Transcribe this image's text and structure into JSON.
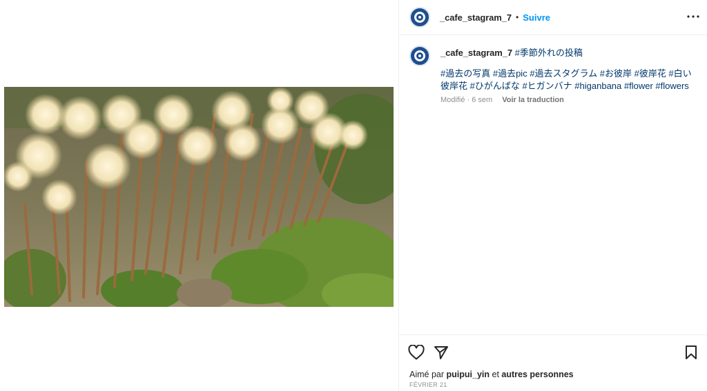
{
  "post": {
    "username": "_cafe_stagram_7",
    "separator": "•",
    "follow_label": "Suivre",
    "more_icon": "more-horizontal-icon",
    "caption_tag": "#季節外れの投稿",
    "hashtags": "#過去の写真 #過去pic #過去スタグラム #お彼岸 #彼岸花 #白い彼岸花 #ひがんばな #ヒガンバナ #higanbana #flower #flowers",
    "edited_label": "Modifié · 6 sem",
    "translate_label": "Voir la traduction",
    "likes_prefix": "Aimé par",
    "liked_by_user": "puipui_yin",
    "likes_connector": "et",
    "likes_others": "autres personnes",
    "date": "FÉVRIER 21"
  },
  "icons": {
    "like": "heart-icon",
    "share": "send-icon",
    "save": "bookmark-icon"
  },
  "colors": {
    "accent": "#0095f6",
    "hashtag": "#00376b",
    "muted": "#8e8e8e"
  },
  "image": {
    "subject": "white spider lilies (higanbana) photo"
  }
}
